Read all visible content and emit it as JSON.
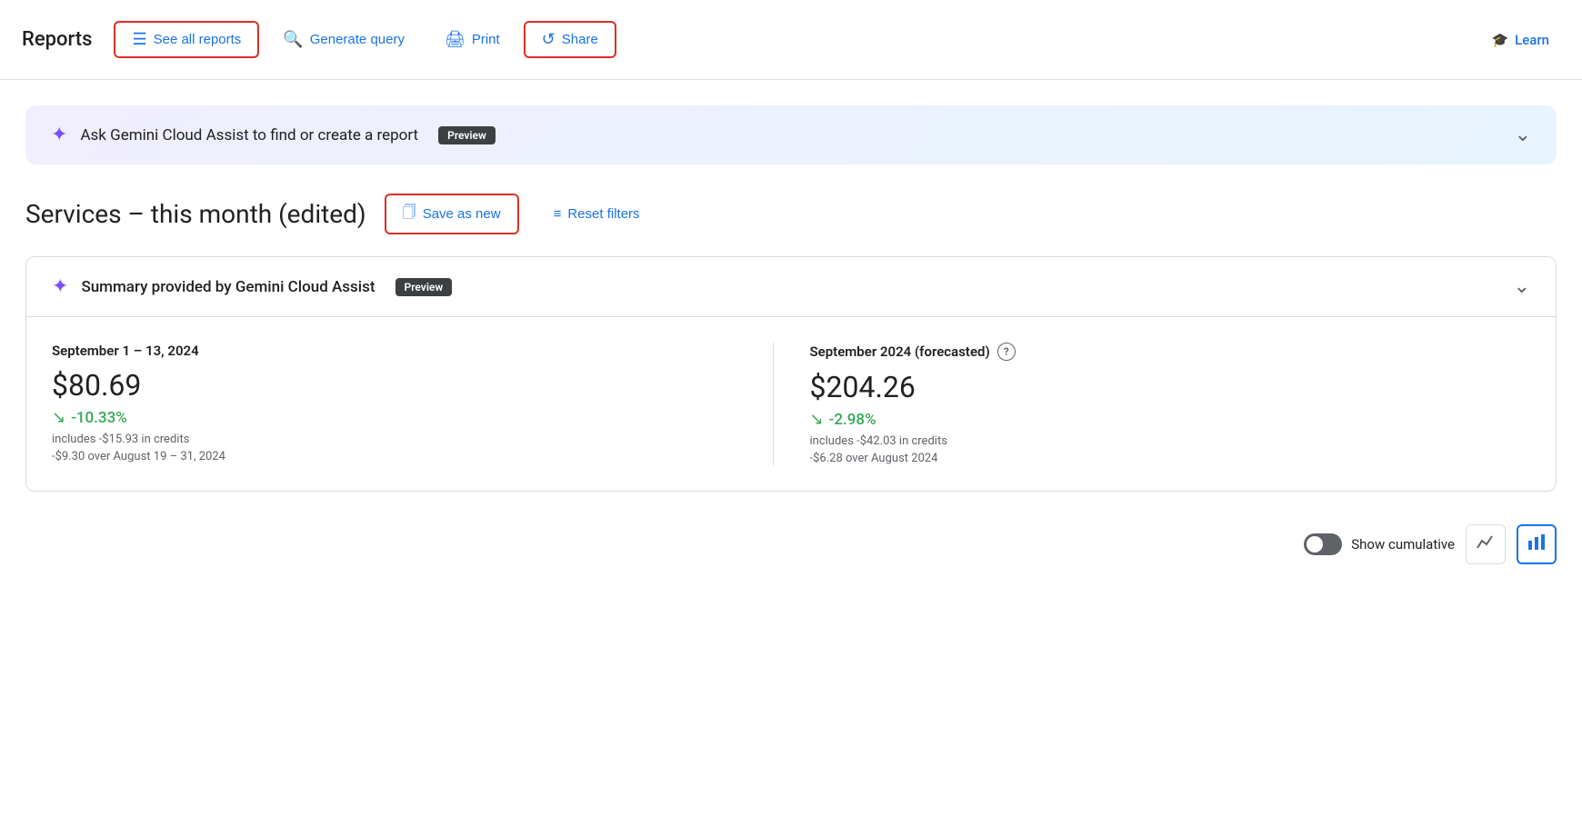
{
  "toolbar": {
    "title": "Reports",
    "see_all_reports": "See all reports",
    "generate_query": "Generate query",
    "print": "Print",
    "share": "Share",
    "learn": "Learn"
  },
  "gemini_banner": {
    "text": "Ask Gemini Cloud Assist to find or create a report",
    "badge": "Preview"
  },
  "report": {
    "title": "Services – this month (edited)",
    "save_as_new": "Save as new",
    "reset_filters": "Reset filters"
  },
  "summary_card": {
    "header": "Summary provided by Gemini Cloud Assist",
    "badge": "Preview",
    "col1": {
      "period": "September 1 – 13, 2024",
      "amount": "$80.69",
      "change": "-10.33%",
      "credits": "includes -$15.93 in credits",
      "subtext": "-$9.30 over August 19 – 31, 2024"
    },
    "col2": {
      "period": "September 2024 (forecasted)",
      "amount": "$204.26",
      "change": "-2.98%",
      "credits": "includes -$42.03 in credits",
      "subtext": "-$6.28 over August 2024"
    }
  },
  "bottom": {
    "show_cumulative": "Show cumulative"
  },
  "icons": {
    "list": "☰",
    "search": "⊕",
    "print": "🖨",
    "share": "↩",
    "learn": "🎓",
    "star": "✦",
    "chevron_down": "∨",
    "save": "⊞",
    "filter": "≡",
    "arrow_down": "↓",
    "line_chart": "∕",
    "bar_chart": "▐"
  }
}
